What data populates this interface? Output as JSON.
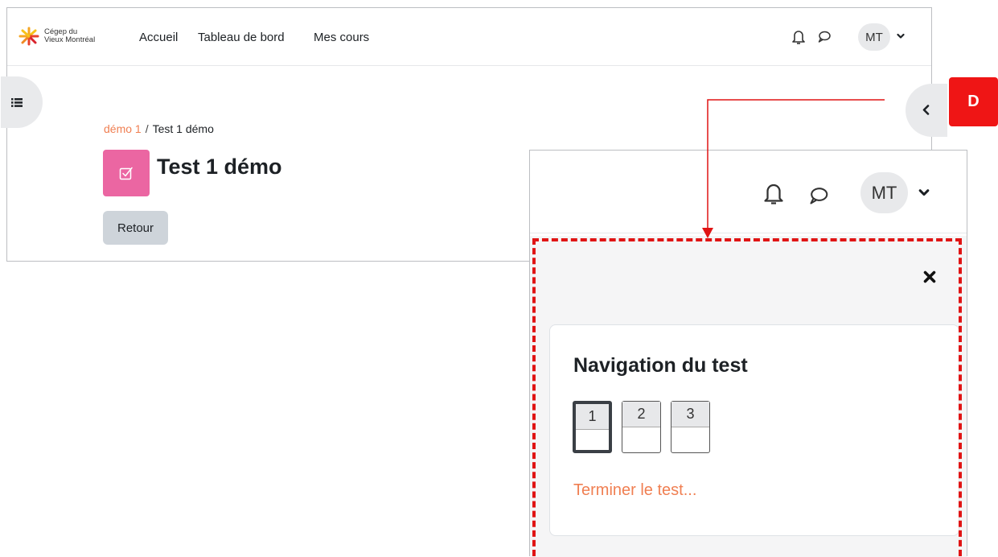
{
  "logo": {
    "line1": "Cégep du",
    "line2": "Vieux Montréal"
  },
  "nav": {
    "home": "Accueil",
    "dashboard": "Tableau de bord",
    "my_courses": "Mes cours"
  },
  "user": {
    "initials": "MT"
  },
  "breadcrumb": {
    "course": "démo 1",
    "separator": "/",
    "current": "Test 1 démo"
  },
  "page": {
    "title": "Test 1 démo",
    "back_label": "Retour"
  },
  "callout": {
    "label": "D",
    "color": "#ef1515"
  },
  "quiz_nav": {
    "title": "Navigation du test",
    "questions": [
      "1",
      "2",
      "3"
    ],
    "current_question": "1",
    "finish_label": "Terminer le test..."
  },
  "colors": {
    "accent": "#f07f52",
    "quiz_icon": "#eb66a2",
    "annotation": "#e01414"
  }
}
